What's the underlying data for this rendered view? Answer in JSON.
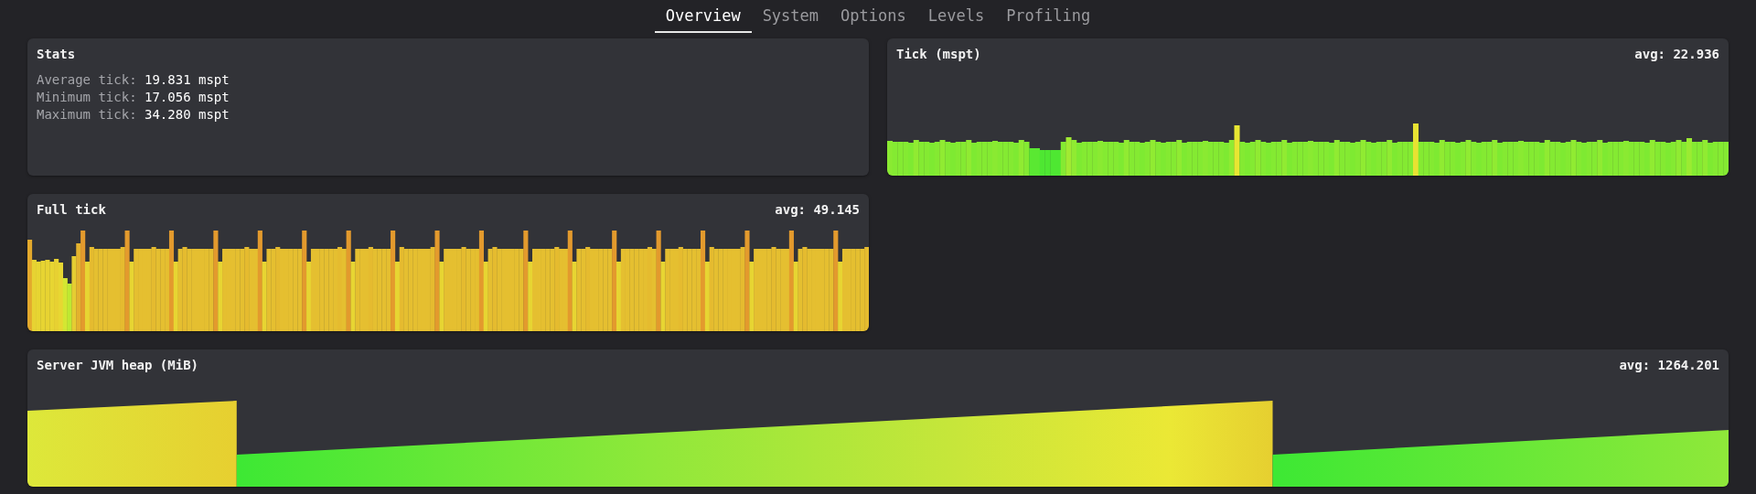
{
  "tabs": [
    {
      "label": "Overview",
      "selected": true
    },
    {
      "label": "System",
      "selected": false
    },
    {
      "label": "Options",
      "selected": false
    },
    {
      "label": "Levels",
      "selected": false
    },
    {
      "label": "Profiling",
      "selected": false
    }
  ],
  "stats": {
    "title": "Stats",
    "rows": [
      {
        "label": "Average tick:",
        "value": "19.831 mspt"
      },
      {
        "label": "Minimum tick:",
        "value": "17.056 mspt"
      },
      {
        "label": "Maximum tick:",
        "value": "34.280 mspt"
      }
    ]
  },
  "graphs": [
    {
      "title": "Tick (mspt)",
      "avg": "avg: 22.936",
      "kind": "lowbars"
    },
    {
      "title": "Full tick",
      "avg": "avg: 49.145",
      "kind": "highbars"
    },
    {
      "title": "Server JVM heap (MiB)",
      "avg": "avg: 1264.201",
      "kind": "sawtooth"
    }
  ]
}
